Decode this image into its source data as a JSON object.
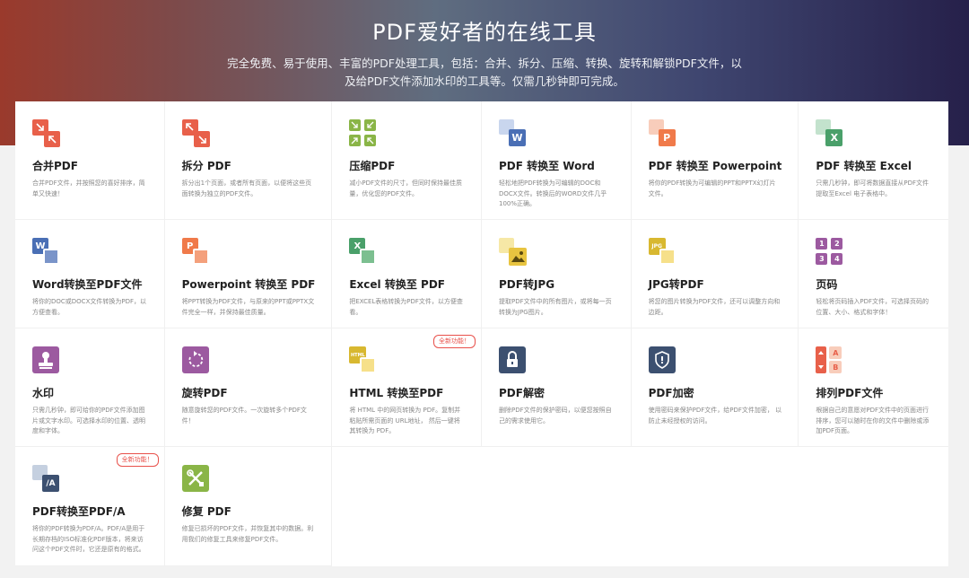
{
  "hero": {
    "title": "PDF爱好者的在线工具",
    "subtitle": "完全免费、易于使用、丰富的PDF处理工具，包括：合并、拆分、压缩、转换、旋转和解锁PDF文件，以及给PDF文件添加水印的工具等。仅需几秒钟即可完成。"
  },
  "colors": {
    "red": "#e8604a",
    "green": "#8ab547",
    "blue": "#4a6fb5",
    "orange": "#f07a4a",
    "excel_green": "#4aa06a",
    "yellow": "#e8c440",
    "purple": "#9c5aa0",
    "slate": "#3c5070",
    "badge_red": "#e8504a"
  },
  "tools": [
    {
      "title": "合并PDF",
      "desc": "合并PDF文件，并按照您的喜好排序，简单又快速！",
      "icon": "merge-icon"
    },
    {
      "title": "拆分 PDF",
      "desc": "拆分出1个页面，或者所有页面，以便将这些页面转换为独立的PDF文件。",
      "icon": "split-icon"
    },
    {
      "title": "压缩PDF",
      "desc": "减小PDF文件的尺寸，但同时保持最佳质量，优化您的PDF文件。",
      "icon": "compress-icon"
    },
    {
      "title": "PDF 转换至 Word",
      "desc": "轻松地把PDF转换为可编辑的DOC和DOCX文件。转换后的WORD文件几乎100%正确。",
      "icon": "pdf-to-word-icon"
    },
    {
      "title": "PDF 转换至 Powerpoint",
      "desc": "将你的PDF转换为可编辑的PPT和PPTX幻灯片文件。",
      "icon": "pdf-to-powerpoint-icon"
    },
    {
      "title": "PDF 转换至 Excel",
      "desc": "只需几秒钟，即可将数据直接从PDF文件提取至Excel 电子表格中。",
      "icon": "pdf-to-excel-icon"
    },
    {
      "title": "Word转换至PDF文件",
      "desc": "将你的DOC或DOCX文件转换为PDF，以方便查看。",
      "icon": "word-to-pdf-icon"
    },
    {
      "title": "Powerpoint 转换至 PDF",
      "desc": "将PPT转换为PDF文件，与原来的PPT或PPTX文件完全一样，并保持最佳质量。",
      "icon": "powerpoint-to-pdf-icon"
    },
    {
      "title": "Excel 转换至 PDF",
      "desc": "把EXCEL表格转换为PDF文件，以方便查看。",
      "icon": "excel-to-pdf-icon"
    },
    {
      "title": "PDF转JPG",
      "desc": "提取PDF文件中的所有图片，或将每一页转换为JPG图片。",
      "icon": "pdf-to-jpg-icon"
    },
    {
      "title": "JPG转PDF",
      "desc": "将您的图片转换为PDF文件，还可以调整方向和边距。",
      "icon": "jpg-to-pdf-icon"
    },
    {
      "title": "页码",
      "desc": "轻松将页码插入PDF文件，可选择页码的位置、大小、格式和字体！",
      "icon": "page-numbers-icon"
    },
    {
      "title": "水印",
      "desc": "只需几秒钟，即可给你的PDF文件添加图片或文字水印。可选择水印的位置、透明度和字体。",
      "icon": "watermark-stamp-icon"
    },
    {
      "title": "旋转PDF",
      "desc": "随意旋转您的PDF文件。一次旋转多个PDF文件！",
      "icon": "rotate-icon"
    },
    {
      "title": "HTML 转换至PDF",
      "desc": "将 HTML 中的网页转换为 PDF。复制并粘贴所需页面的 URL地址， 然后一键将其转换为 PDF。",
      "icon": "html-to-pdf-icon",
      "badge": "全新功能！"
    },
    {
      "title": "PDF解密",
      "desc": "删除PDF文件的保护密码，以便您按照自己的需求使用它。",
      "icon": "unlock-icon"
    },
    {
      "title": "PDF加密",
      "desc": "使用密码来保护PDF文件，给PDF文件加密， 以防止未经授权的访问。",
      "icon": "shield-icon"
    },
    {
      "title": "排列PDF文件",
      "desc": "根据自己的意愿对PDF文件中的页面进行排序，您可以随时在你的文件中删除或添加PDF页面。",
      "icon": "organize-icon"
    },
    {
      "title": "PDF转换至PDF/A",
      "desc": "将你的PDF转换为PDF/A。PDF/A是用于长期存档的ISO标准化PDF版本，将来访问这个PDF文件时，它还是原有的格式。",
      "icon": "pdf-to-pdfa-icon",
      "badge": "全新功能！"
    },
    {
      "title": "修复 PDF",
      "desc": "修复已损坏的PDF文件，并恢复其中的数据。利用我们的修复工具来修复PDF文件。",
      "icon": "repair-tools-icon"
    }
  ],
  "icon_glyphs": {
    "word": "W",
    "ppt": "P",
    "excel": "X",
    "pdfa": "/A",
    "html": "HTML",
    "jpg": "JPG",
    "ab": "A",
    "bb": "B",
    "n1": "1",
    "n2": "2",
    "n3": "3",
    "n4": "4"
  }
}
